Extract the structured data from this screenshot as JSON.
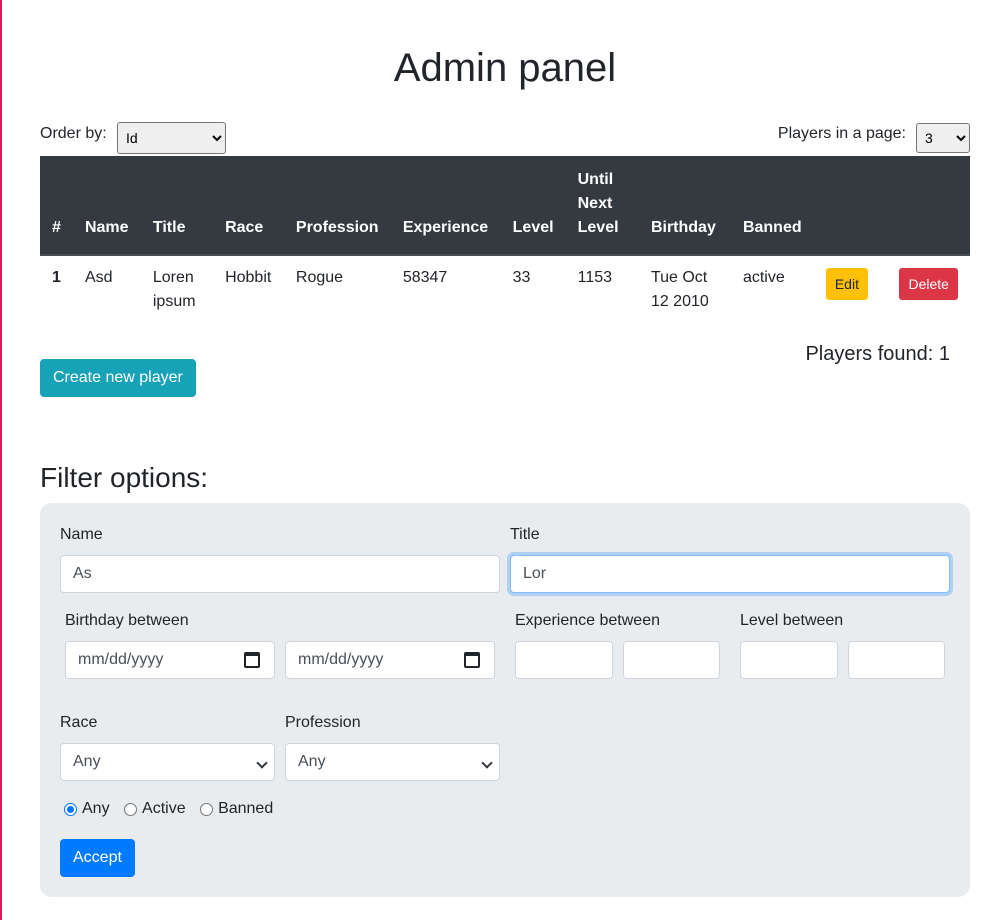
{
  "header": {
    "title": "Admin panel"
  },
  "controls": {
    "order_label": "Order by:",
    "order_selected": "Id",
    "per_page_label": "Players in a page:",
    "per_page_selected": "3"
  },
  "table": {
    "columns": [
      "#",
      "Name",
      "Title",
      "Race",
      "Profession",
      "Experience",
      "Level",
      "Until Next Level",
      "Birthday",
      "Banned",
      "",
      ""
    ],
    "rows": [
      {
        "id": "1",
        "name": "Asd",
        "title": "Loren ipsum",
        "race": "Hobbit",
        "profession": "Rogue",
        "experience": "58347",
        "level": "33",
        "until_next_level": "1153",
        "birthday": "Tue Oct 12 2010",
        "banned": "active",
        "edit_label": "Edit",
        "delete_label": "Delete"
      }
    ]
  },
  "actions": {
    "create_label": "Create new player"
  },
  "summary": {
    "players_found": "Players found: 1"
  },
  "filter": {
    "title": "Filter options:",
    "name_label": "Name",
    "name_value": "As",
    "title_label": "Title",
    "title_value": "Lor",
    "birthday_label": "Birthday between",
    "date_placeholder": "mm/dd/yyyy",
    "experience_label": "Experience between",
    "level_label": "Level between",
    "race_label": "Race",
    "race_selected": "Any",
    "profession_label": "Profession",
    "profession_selected": "Any",
    "status_options": [
      "Any",
      "Active",
      "Banned"
    ],
    "status_selected": "Any",
    "accept_label": "Accept"
  },
  "colors": {
    "table_header": "#343a40",
    "edit": "#ffc107",
    "delete": "#dc3545",
    "create": "#17a2b8",
    "accept": "#007bff",
    "filter_bg": "#e9ecef",
    "accent_bar": "#d81b60"
  }
}
